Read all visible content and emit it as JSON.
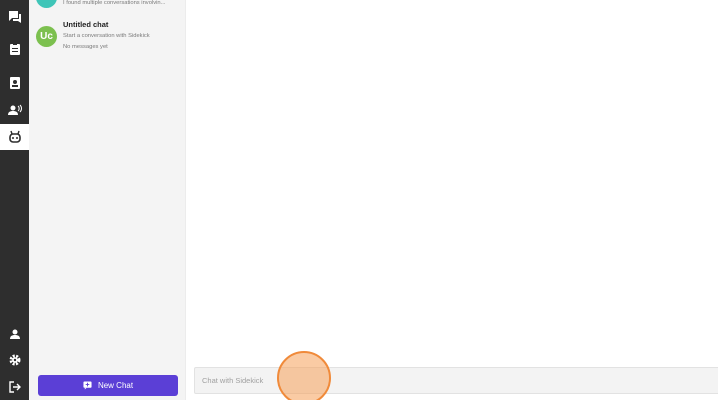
{
  "rail": {
    "items": [
      {
        "icon": "chat-bubbles-icon",
        "active": false
      },
      {
        "icon": "clipboard-icon",
        "active": false
      },
      {
        "icon": "contact-card-icon",
        "active": false
      },
      {
        "icon": "voice-person-icon",
        "active": false
      },
      {
        "icon": "robot-icon",
        "active": true
      }
    ],
    "bottom": [
      {
        "icon": "user-icon"
      },
      {
        "icon": "gear-icon"
      },
      {
        "icon": "logout-icon"
      }
    ]
  },
  "conversations": [
    {
      "avatar_text": "",
      "avatar_color": "#3fc5b8",
      "title": "",
      "preview": "I found multiple conversations involvin...",
      "status": ""
    },
    {
      "avatar_text": "Uc",
      "avatar_color": "#7cc04f",
      "title": "Untitled chat",
      "preview": "Start a conversation with Sidekick",
      "status": "No messages yet"
    }
  ],
  "new_chat": {
    "label": "New Chat"
  },
  "chat_input": {
    "placeholder": "Chat with Sidekick"
  },
  "colors": {
    "accent": "#5b3fd6",
    "rail_bg": "#2e2e2e",
    "cursor": "#f08a3a"
  }
}
